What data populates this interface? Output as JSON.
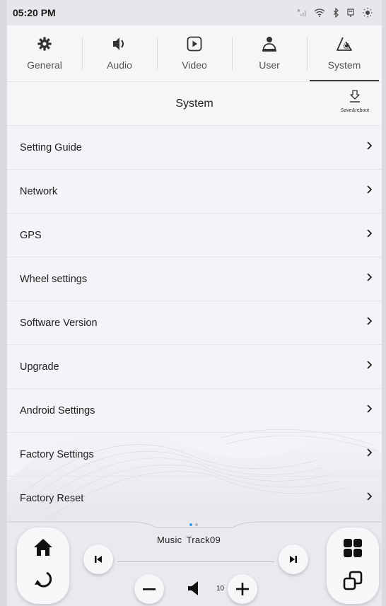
{
  "status": {
    "time": "05:20 PM",
    "icons": [
      "signal-off-icon",
      "wifi-icon",
      "bluetooth-icon",
      "usb-icon",
      "brightness-icon"
    ]
  },
  "tabs": [
    {
      "label": "General",
      "icon": "gear-icon",
      "active": false
    },
    {
      "label": "Audio",
      "icon": "speaker-icon",
      "active": false
    },
    {
      "label": "Video",
      "icon": "play-icon",
      "active": false
    },
    {
      "label": "User",
      "icon": "user-icon",
      "active": false
    },
    {
      "label": "System",
      "icon": "system-icon",
      "active": true
    }
  ],
  "header": {
    "title": "System",
    "save_label": "Save&reboot"
  },
  "menu": [
    {
      "label": "Setting Guide"
    },
    {
      "label": "Network"
    },
    {
      "label": "GPS"
    },
    {
      "label": "Wheel settings"
    },
    {
      "label": "Software Version"
    },
    {
      "label": "Upgrade"
    },
    {
      "label": "Android Settings"
    },
    {
      "label": "Factory Settings"
    },
    {
      "label": "Factory Reset"
    }
  ],
  "chevron": ">",
  "player": {
    "source": "Music",
    "track": "Track09",
    "volume": "10",
    "page_dots": 2,
    "active_dot": 0
  },
  "colors": {
    "background": "#f3f4f7",
    "accent_dot": "#3aa0e6",
    "text": "#222222"
  }
}
